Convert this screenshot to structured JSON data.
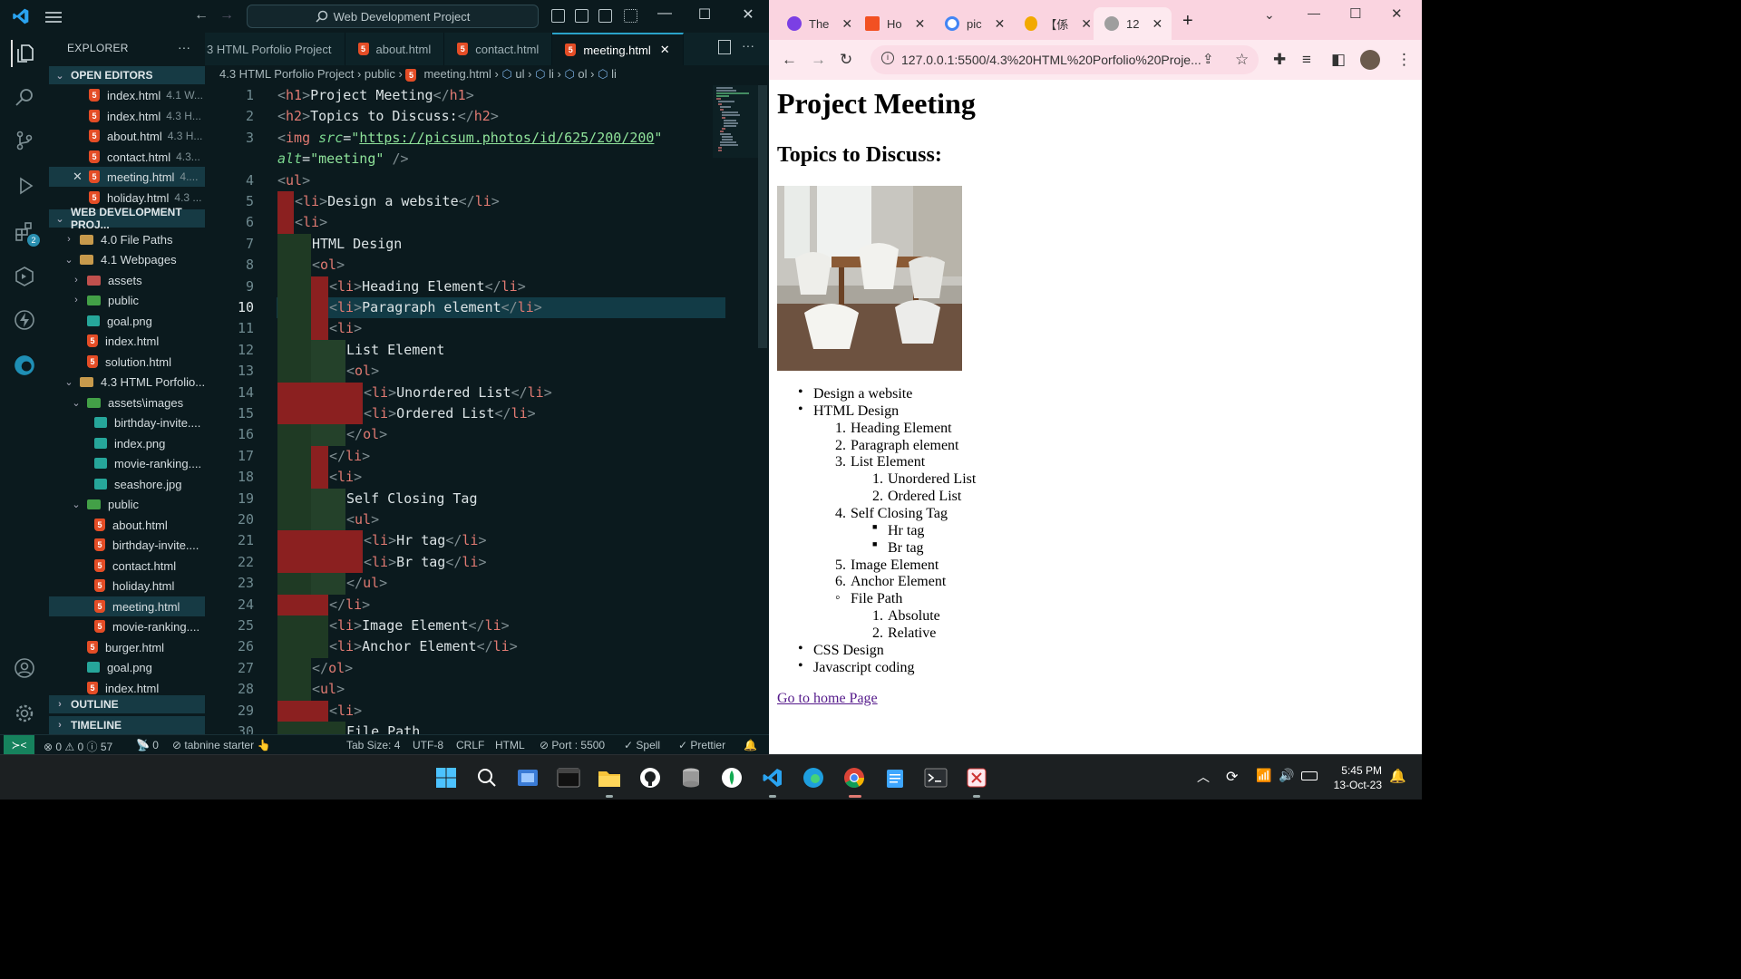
{
  "vscode": {
    "command_center": "Web Development Project",
    "explorer_title": "EXPLORER",
    "sections": {
      "open_editors": "OPEN EDITORS",
      "project": "WEB DEVELOPMENT PROJ...",
      "outline": "OUTLINE",
      "timeline": "TIMELINE"
    },
    "open_editors": [
      {
        "name": "index.html",
        "desc": "4.1 W..."
      },
      {
        "name": "index.html",
        "desc": "4.3 H..."
      },
      {
        "name": "about.html",
        "desc": "4.3 H..."
      },
      {
        "name": "contact.html",
        "desc": "4.3..."
      },
      {
        "name": "meeting.html",
        "desc": "4...."
      },
      {
        "name": "holiday.html",
        "desc": "4.3 ..."
      }
    ],
    "tree": [
      "4.0 File Paths",
      "4.1 Webpages",
      "assets",
      "public",
      "goal.png",
      "index.html",
      "solution.html",
      "4.3 HTML Porfolio...",
      "assets\\images",
      "birthday-invite....",
      "index.png",
      "movie-ranking....",
      "seashore.jpg",
      "public",
      "about.html",
      "birthday-invite....",
      "contact.html",
      "holiday.html",
      "meeting.html",
      "movie-ranking....",
      "burger.html",
      "goal.png",
      "index.html"
    ],
    "tabs": [
      "3 HTML Porfolio Project",
      "about.html",
      "contact.html",
      "meeting.html"
    ],
    "breadcrumb": [
      "4.3 HTML Porfolio Project",
      "public",
      "meeting.html",
      "ul",
      "li",
      "ol",
      "li"
    ],
    "line_numbers": [
      "1",
      "2",
      "3",
      "",
      "4",
      "5",
      "6",
      "7",
      "8",
      "9",
      "10",
      "11",
      "12",
      "13",
      "14",
      "15",
      "16",
      "17",
      "18",
      "19",
      "20",
      "21",
      "22",
      "23",
      "24",
      "25",
      "26",
      "27",
      "28",
      "29",
      "30"
    ],
    "status": {
      "errors": "0",
      "warnings": "0",
      "info": "57",
      "ports_fwd": "0",
      "tabnine": "tabnine starter",
      "tab_size": "Tab Size: 4",
      "encoding": "UTF-8",
      "eol": "CRLF",
      "lang": "HTML",
      "port": "Port : 5500",
      "spell": "Spell",
      "prettier": "Prettier"
    }
  },
  "chrome": {
    "tabs": [
      {
        "title": "The",
        "color": "#7b3fe4"
      },
      {
        "title": "Ho",
        "color": "#f25022"
      },
      {
        "title": "pic",
        "color": "#4285f4"
      },
      {
        "title": "【係",
        "color": "#f2a900"
      },
      {
        "title": "12",
        "color": "#9e9e9e"
      }
    ],
    "url": "127.0.0.1:5500/4.3%20HTML%20Porfolio%20Proje...",
    "page": {
      "h1": "Project Meeting",
      "h2": "Topics to Discuss:",
      "list": [
        "Design a website",
        "HTML Design",
        "Heading Element",
        "Paragraph element",
        "List Element",
        "Unordered List",
        "Ordered List",
        "Self Closing Tag",
        "Hr tag",
        "Br tag",
        "Image Element",
        "Anchor Element",
        "File Path",
        "Absolute",
        "Relative",
        "CSS Design",
        "Javascript coding"
      ],
      "markers": [
        "1.",
        "2.",
        "3.",
        "1.",
        "2.",
        "4.",
        "5.",
        "6.",
        "1.",
        "2."
      ],
      "link": "Go to home Page"
    }
  },
  "taskbar": {
    "time": "5:45 PM",
    "date": "13-Oct-23"
  }
}
